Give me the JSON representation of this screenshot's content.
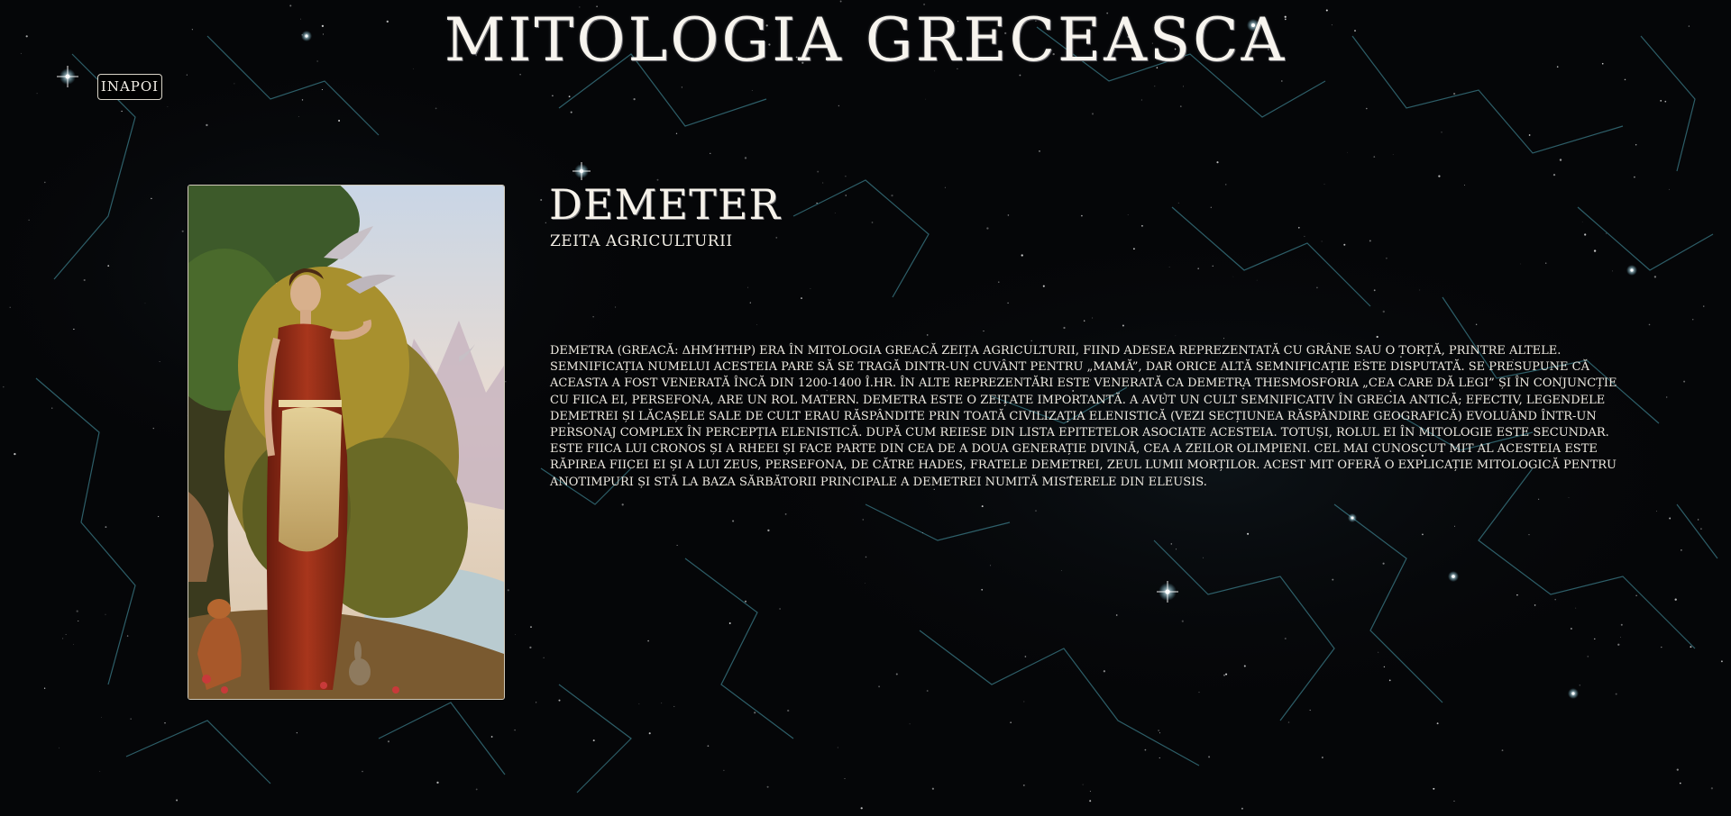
{
  "site": {
    "title": "MITOLOGIA GRECEASCA"
  },
  "nav": {
    "back_label": "INAPOI"
  },
  "article": {
    "name": "DEMETER",
    "subtitle": "ZEITA AGRICULTURII",
    "image_subject": "portrait of Demeter with animals and birds in a landscape",
    "description": "DEMETRA (GREACĂ: Δημήτηρ) ERA ÎN MITOLOGIA GREACĂ ZEIȚA AGRICULTURII, FIIND ADESEA REPREZENTATĂ CU GRÂNE SAU O TORȚĂ, PRINTRE ALTELE. SEMNIFICAȚIA NUMELUI ACESTEIA PARE SĂ SE TRAGĂ DINTR-UN CUVÂNT PENTRU „MAMĂ”, DAR ORICE ALTĂ SEMNIFICAȚIE ESTE DISPUTATĂ. SE PRESUPUNE CĂ ACEASTA A FOST VENERATĂ ÎNCĂ DIN 1200-1400 Î.HR. ÎN ALTE REPREZENTĂRI ESTE VENERATĂ CA DEMETRA THESMOSFORIA „CEA CARE DĂ LEGI” ȘI ÎN CONJUNCȚIE CU FIICA EI, PERSEFONA, ARE UN ROL MATERN. DEMETRA ESTE O ZEIȚATE IMPORTANTĂ. A AVUT UN CULT SEMNIFICATIV ÎN GRECIA ANTICĂ; EFECTIV, LEGENDELE DEMETREI ȘI LĂCAȘELE SALE DE CULT ERAU RĂSPÂNDITE PRIN TOATĂ CIVILIZAȚIA ELENISTICĂ (VEZI SECȚIUNEA RĂSPÂNDIRE GEOGRAFICĂ) EVOLUÂND ÎNTR-UN PERSONAJ COMPLEX ÎN PERCEPȚIA ELENISTICĂ. DUPĂ CUM REIESE DIN LISTA EPITETELOR ASOCIATE ACESTEIA. TOTUȘI, ROLUL EI ÎN MITOLOGIE ESTE SECUNDAR. ESTE FIICA LUI CRONOS ȘI A RHEEI ȘI FACE PARTE DIN CEA DE A DOUA GENERAȚIE DIVINĂ, CEA A ZEILOR OLIMPIENI. CEL MAI CUNOSCUT MIT AL ACESTEIA ESTE RĂPIREA FIICEI EI ȘI A LUI ZEUS, PERSEFONA, DE CĂTRE HADES, FRATELE DEMETREI, ZEUL LUMII MORȚILOR. ACEST MIT OFERĂ O EXPLICAȚIE MITOLOGICĂ PENTRU ANOTIMPURI ȘI STĂ LA BAZA SĂRBĂTORII PRINCIPALE A DEMETREI NUMITĂ MISTERELE DIN ELEUSIS."
  },
  "colors": {
    "background": "#050608",
    "text": "#f2eee6",
    "constellation_lines": "#4fa7b8",
    "stars": "#ffffff"
  }
}
